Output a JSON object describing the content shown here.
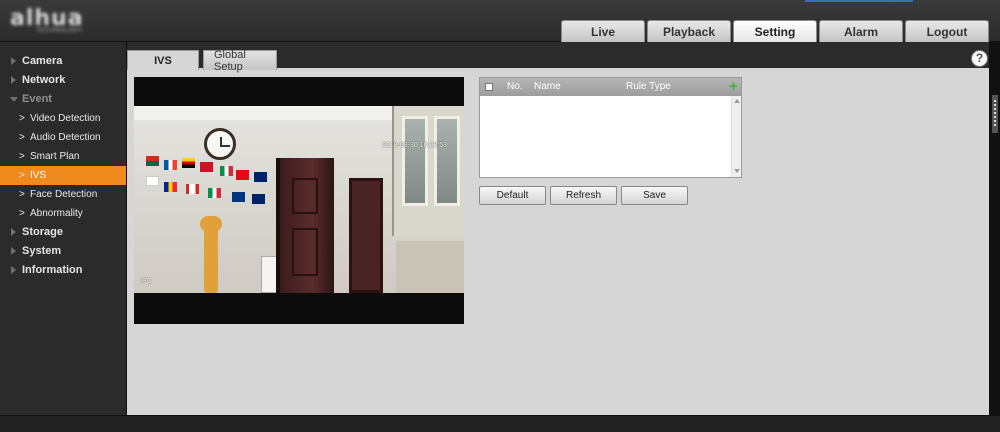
{
  "header": {
    "logo_text": "alhua",
    "logo_subtext": "TECHNOLOGY",
    "nav": [
      {
        "label": "Live",
        "active": false
      },
      {
        "label": "Playback",
        "active": false
      },
      {
        "label": "Setting",
        "active": true
      },
      {
        "label": "Alarm",
        "active": false
      },
      {
        "label": "Logout",
        "active": false
      }
    ]
  },
  "sidebar": {
    "items": [
      {
        "label": "Camera",
        "level": "top"
      },
      {
        "label": "Network",
        "level": "top"
      },
      {
        "label": "Event",
        "level": "top",
        "expanded": true
      },
      {
        "label": "Video Detection",
        "level": "sub"
      },
      {
        "label": "Audio Detection",
        "level": "sub"
      },
      {
        "label": "Smart Plan",
        "level": "sub"
      },
      {
        "label": "IVS",
        "level": "sub",
        "active": true
      },
      {
        "label": "Face Detection",
        "level": "sub"
      },
      {
        "label": "Abnormality",
        "level": "sub"
      },
      {
        "label": "Storage",
        "level": "top"
      },
      {
        "label": "System",
        "level": "top"
      },
      {
        "label": "Information",
        "level": "top"
      }
    ]
  },
  "content": {
    "tabs": [
      {
        "label": "IVS",
        "active": true
      },
      {
        "label": "Global Setup",
        "active": false
      }
    ],
    "help_label": "?",
    "video": {
      "timestamp": "2018-08-30 10:23:53",
      "channel_label": "IPC"
    },
    "rule_table": {
      "columns": [
        "No.",
        "Name",
        "Rule Type"
      ],
      "rows": []
    },
    "buttons": {
      "default": "Default",
      "refresh": "Refresh",
      "save": "Save"
    }
  },
  "colors": {
    "accent": "#ee8a1e",
    "background": "#d6d6d6",
    "add_icon": "#3cb33c"
  }
}
